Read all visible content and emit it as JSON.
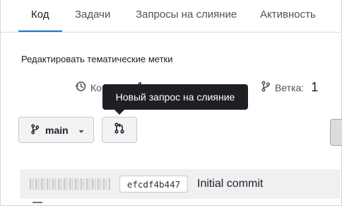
{
  "tabs": [
    {
      "label": "Код",
      "active": true
    },
    {
      "label": "Задачи",
      "active": false
    },
    {
      "label": "Запросы на слияние",
      "active": false
    },
    {
      "label": "Активность",
      "active": false
    }
  ],
  "edit_topics": "Редактировать тематические метки",
  "stats": {
    "commits_label": "Коммиты",
    "commits_count": "1",
    "branches_label": "Ветка:",
    "branches_count": "1"
  },
  "tooltip": "Новый запрос на слияние",
  "branch_selector": {
    "label": "main",
    "icon": "branch-icon",
    "chevron": "chevron-down-icon"
  },
  "merge_request_button": {
    "icon": "merge-request-icon"
  },
  "last_commit": {
    "sha": "efcdf4b447",
    "message": "Initial commit"
  },
  "colors": {
    "accent": "#1f75cb",
    "tooltip_bg": "#1f1e24",
    "row_bg": "#f0f0f2"
  }
}
